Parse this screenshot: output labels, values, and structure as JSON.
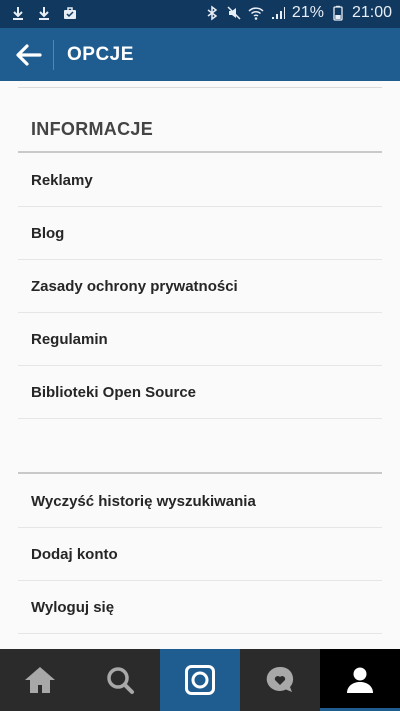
{
  "status_bar": {
    "battery_percent": "21%",
    "time": "21:00",
    "left_icons": [
      "download-icon",
      "download-icon",
      "briefcase-icon"
    ],
    "right_icons": [
      "bluetooth-icon",
      "mute-icon",
      "wifi-icon",
      "signal-icon",
      "battery-icon"
    ]
  },
  "app_bar": {
    "title": "OPCJE",
    "back_icon": "back-arrow-icon"
  },
  "sections": {
    "info_header": "INFORMACJE",
    "info_items": [
      "Reklamy",
      "Blog",
      "Zasady ochrony prywatności",
      "Regulamin",
      "Biblioteki Open Source"
    ],
    "account_items": [
      "Wyczyść historię wyszukiwania",
      "Dodaj konto",
      "Wyloguj się"
    ]
  },
  "bottom_nav": {
    "tabs": [
      "home-icon",
      "search-icon",
      "camera-icon",
      "activity-icon",
      "profile-icon"
    ],
    "active_tab": "profile-icon"
  },
  "colors": {
    "status_bar": "#11385f",
    "app_bar": "#1f5d90",
    "bottom_nav": "#2b2b2b",
    "accent": "#1f5d90"
  }
}
